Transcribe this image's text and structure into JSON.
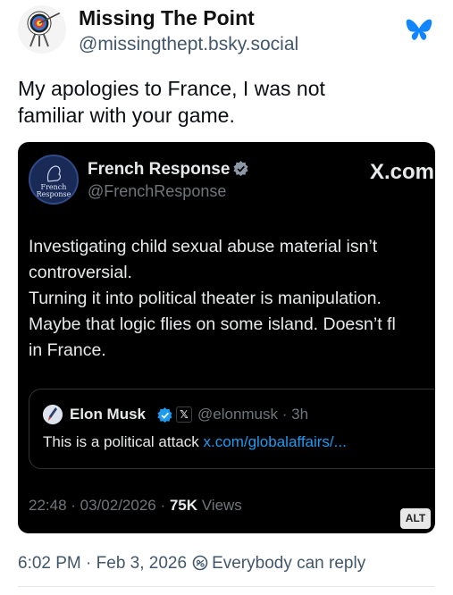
{
  "post": {
    "display_name": "Missing The Point",
    "handle": "@missingthept.bsky.social",
    "text_line1": "My apologies to France, I was not",
    "text_line2": "familiar with your game.",
    "timestamp": "6:02 PM · Feb 3, 2026",
    "reply_setting": "Everybody can reply"
  },
  "embed": {
    "avatar_text_1": "French",
    "avatar_text_2": "Response",
    "name": "French Response",
    "handle": "@FrenchResponse",
    "site": "X.com",
    "body_lines": [
      "Investigating child sexual abuse material isn’t",
      "controversial.",
      "Turning it into political theater is manipulation.",
      "Maybe that logic flies on some island. Doesn’t fl",
      "in France."
    ],
    "quote": {
      "name": "Elon Musk",
      "handle": "@elonmusk · 3h",
      "text": "This is a political attack ",
      "link": "x.com/globalaffairs/..."
    },
    "meta_date": "22:48 · 03/02/2026 · ",
    "meta_views_count": "75K",
    "meta_views_label": " Views",
    "alt_label": "ALT"
  },
  "colors": {
    "bluesky_blue": "#1185fe",
    "x_verified_blue": "#1d9bf0",
    "link_blue": "#1d9bf0"
  }
}
